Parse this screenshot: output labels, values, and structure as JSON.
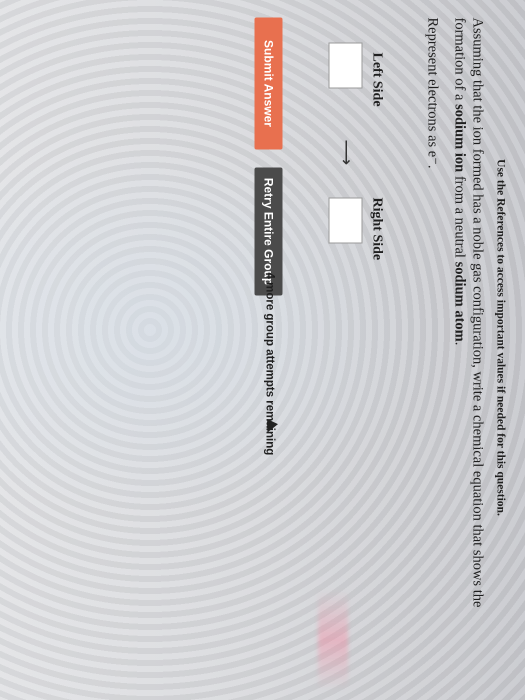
{
  "reference_note": "Use the References to access important values if needed for this question.",
  "question": {
    "text_before": "Assuming that the ion formed has a noble gas configuration, write a chemical equation that shows the formation of a ",
    "bold_ion": "sodium ion",
    "text_middle": " from a neutral ",
    "bold_atom": "sodium atom",
    "text_after": "."
  },
  "electrons_prompt": "Represent electrons as e⁻.",
  "equation": {
    "left_label": "Left Side",
    "right_label": "Right Side",
    "arrow": "⟶"
  },
  "buttons": {
    "submit": "Submit Answer",
    "retry": "Retry Entire Group"
  },
  "attempts_text": "4 more group attempts remaining",
  "colors": {
    "submit_button": "#e8704f",
    "retry_button": "#4b4b4b"
  }
}
